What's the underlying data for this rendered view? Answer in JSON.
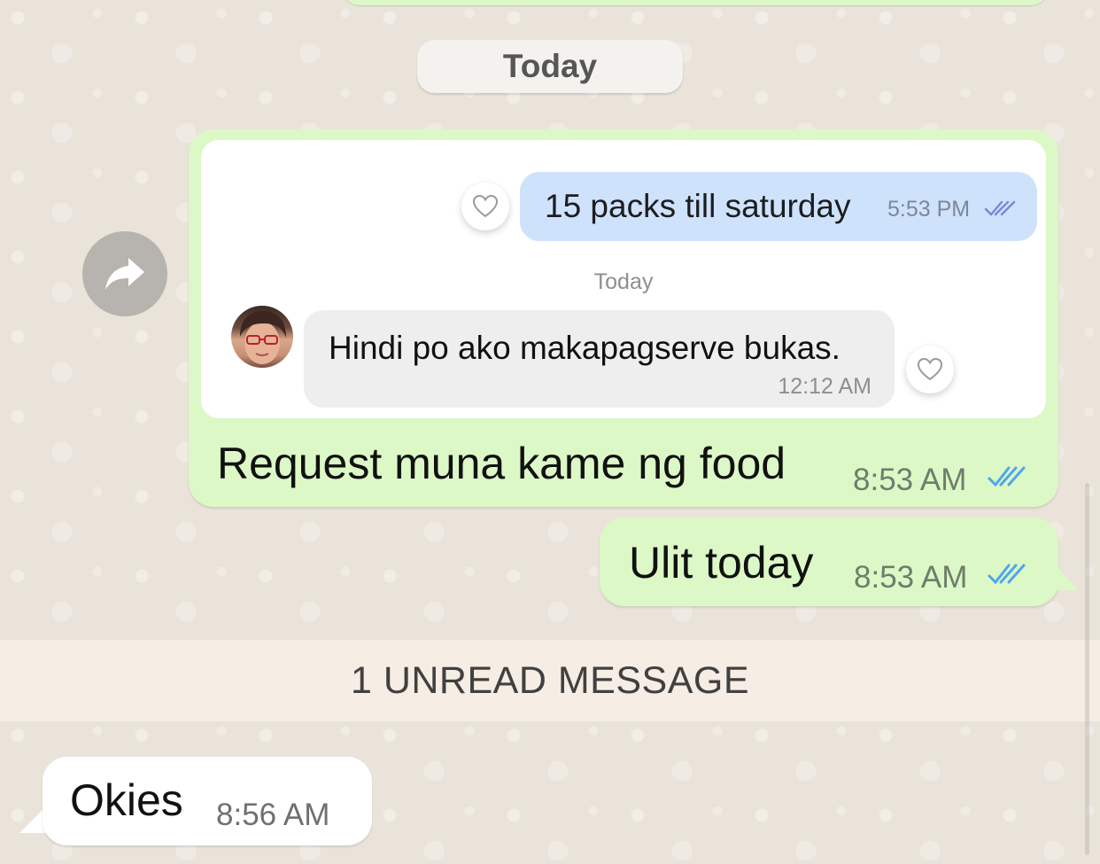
{
  "date_separator": "Today",
  "forward": {
    "icon": "forward-arrow-icon"
  },
  "forwarded_screenshot": {
    "outgoing_message": {
      "text": "15 packs till saturday",
      "time": "5:53 PM",
      "status_icon": "double-check-icon",
      "bubble_color": "#cfe2fb"
    },
    "date_label": "Today",
    "incoming_message": {
      "text": "Hindi po ako makapagserve bukas.",
      "time": "12:12 AM",
      "bubble_color": "#eeeeef"
    },
    "like_icon": "heart-outline-icon"
  },
  "messages": [
    {
      "text": "Request muna kame ng food",
      "time": "8:53 AM",
      "status_icon": "double-check-icon",
      "direction": "outgoing"
    },
    {
      "text": "Ulit today",
      "time": "8:53 AM",
      "status_icon": "double-check-icon",
      "direction": "outgoing"
    }
  ],
  "unread_banner": "1 UNREAD MESSAGE",
  "incoming": {
    "text": "Okies",
    "time": "8:56 AM",
    "direction": "incoming"
  },
  "colors": {
    "outgoing_bubble": "#dcf8c6",
    "incoming_bubble": "#ffffff",
    "read_check": "#4fa6e8",
    "wallpaper": "#e9e3da"
  }
}
